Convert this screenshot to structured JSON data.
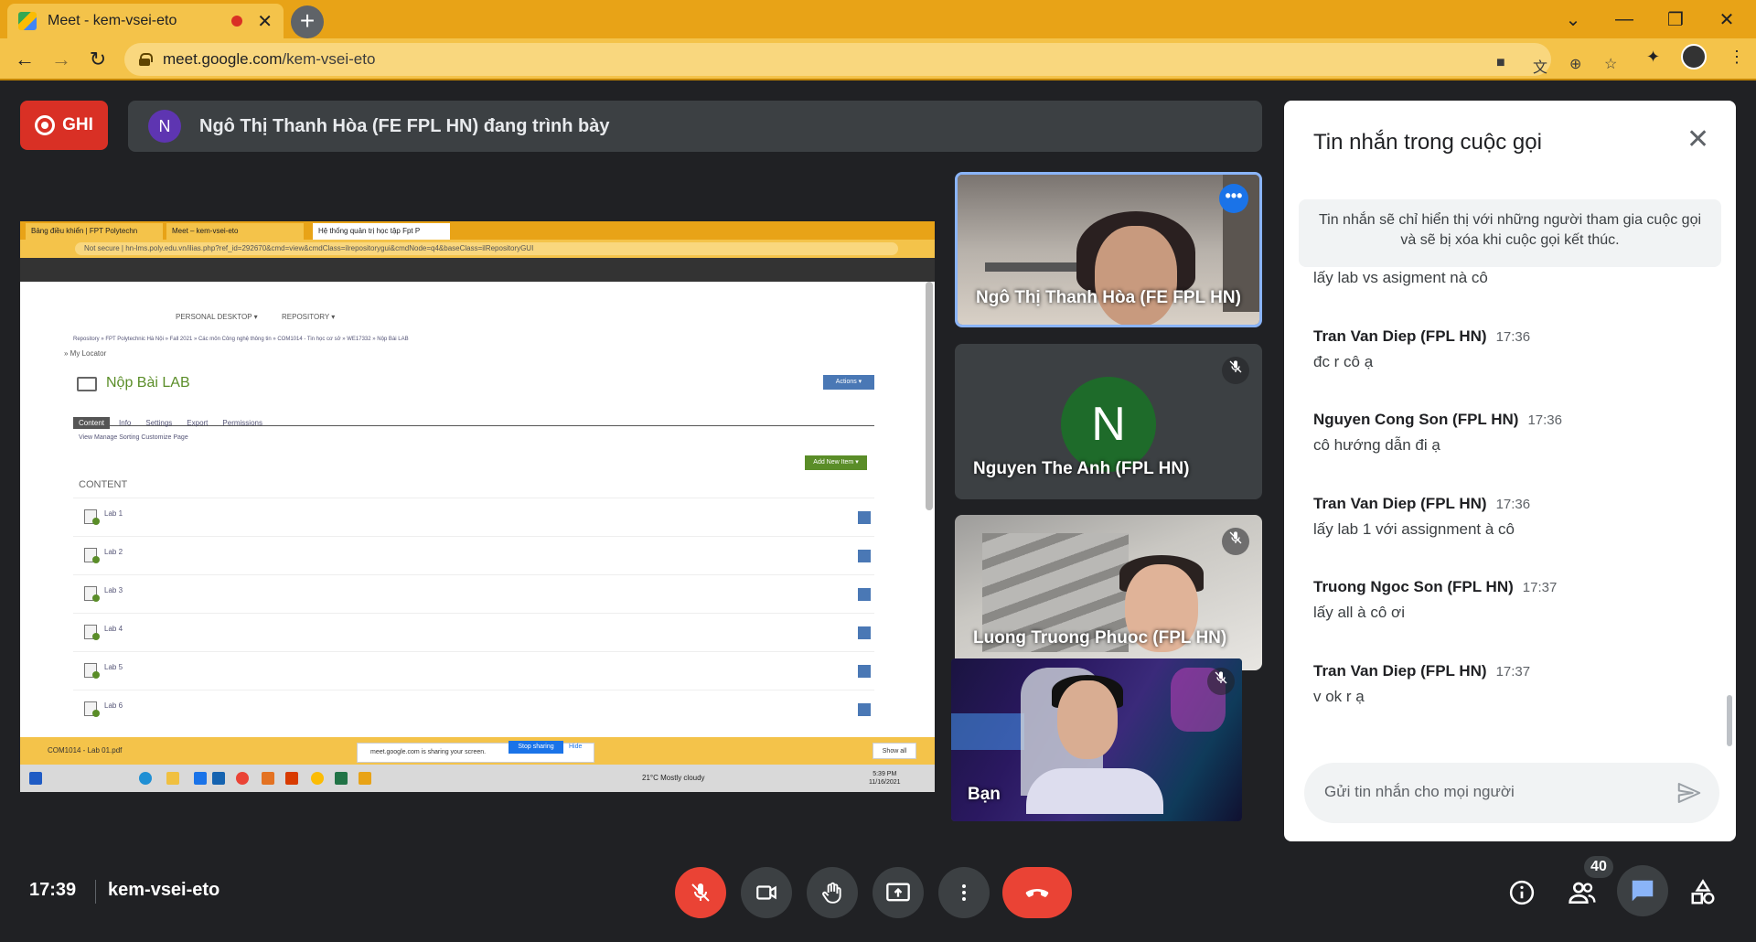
{
  "browser": {
    "tab_title": "Meet - kem-vsei-eto",
    "tab_close": "✕",
    "new_tab": "+",
    "url_host": "meet.google.com",
    "url_path": "/kem-vsei-eto",
    "accent_color": "#e8a317"
  },
  "topbar": {
    "record_label": "GHI",
    "presenter_initial": "N",
    "presenting_text": "Ngô Thị Thanh Hòa (FE FPL HN) đang trình bày"
  },
  "shared_screen": {
    "tabs": [
      "Bảng điều khiển | FPT Polytechn",
      "Meet – kem-vsei-eto",
      "Hệ thống quản trị học tập Fpt P"
    ],
    "url": "Not secure | hn-lms.poly.edu.vn/ilias.php?ref_id=292670&cmd=view&cmdClass=ilrepositorygui&cmdNode=q4&baseClass=ilRepositoryGUI",
    "menu": [
      "PERSONAL DESKTOP ▾",
      "REPOSITORY ▾"
    ],
    "breadcrumb": "Repository » FPT Polytechnic Hà Nội » Fall 2021 » Các môn Công nghệ thông tin » COM1014 - Tin học cơ sở » WE17332 » Nộp Bài LAB",
    "locator": "» My Locator",
    "title": "Nộp Bài LAB",
    "actions": "Actions ▾",
    "subtabs": [
      "Content",
      "Info",
      "Settings",
      "Export",
      "Permissions"
    ],
    "subnav": "View    Manage    Sorting    Customize Page",
    "add_new": "Add New Item ▾",
    "content_label": "CONTENT",
    "items": [
      "Lab 1",
      "Lab 2",
      "Lab 3",
      "Lab 4",
      "Lab 5",
      "Lab 6"
    ],
    "download_file": "COM1014 - Lab 01.pdf",
    "share_notice": "meet.google.com is sharing your screen.",
    "stop_sharing": "Stop sharing",
    "hide": "Hide",
    "show_all": "Show all",
    "weather": "21°C  Mostly cloudy",
    "clock_time": "5:39 PM",
    "clock_date": "11/16/2021"
  },
  "participants": [
    {
      "name": "Ngô Thị Thanh Hòa (FE FPL HN)"
    },
    {
      "name": "Nguyen The Anh (FPL HN)",
      "initial": "N"
    },
    {
      "name": "Luong Truong Phuoc (FPL HN)"
    },
    {
      "name": "Bạn"
    }
  ],
  "chat": {
    "title": "Tin nhắn trong cuộc gọi",
    "close": "✕",
    "notice": "Tin nhắn sẽ chỉ hiển thị với những người tham gia cuộc gọi và sẽ bị xóa khi cuộc gọi kết thúc.",
    "cut_message": "lấy lab vs asigment nà cô",
    "messages": [
      {
        "name": "Tran Van Diep (FPL HN)",
        "time": "17:36",
        "text": "đc r cô ạ"
      },
      {
        "name": "Nguyen Cong Son (FPL HN)",
        "time": "17:36",
        "text": "cô hướng dẫn đi ạ"
      },
      {
        "name": "Tran Van Diep (FPL HN)",
        "time": "17:36",
        "text": "lấy lab 1 với assignment à cô"
      },
      {
        "name": "Truong Ngoc Son (FPL HN)",
        "time": "17:37",
        "text": "lấy all à cô ơi"
      },
      {
        "name": "Tran Van Diep (FPL HN)",
        "time": "17:37",
        "text": "v ok r ạ"
      }
    ],
    "input_placeholder": "Gửi tin nhắn cho mọi người"
  },
  "bottom": {
    "time": "17:39",
    "meeting_code": "kem-vsei-eto",
    "people_count": "40",
    "icons": [
      "mic-off-icon",
      "camera-icon",
      "raise-hand-icon",
      "present-icon",
      "more-icon",
      "leave-call-icon",
      "info-icon",
      "people-icon",
      "chat-icon",
      "activities-icon"
    ]
  }
}
